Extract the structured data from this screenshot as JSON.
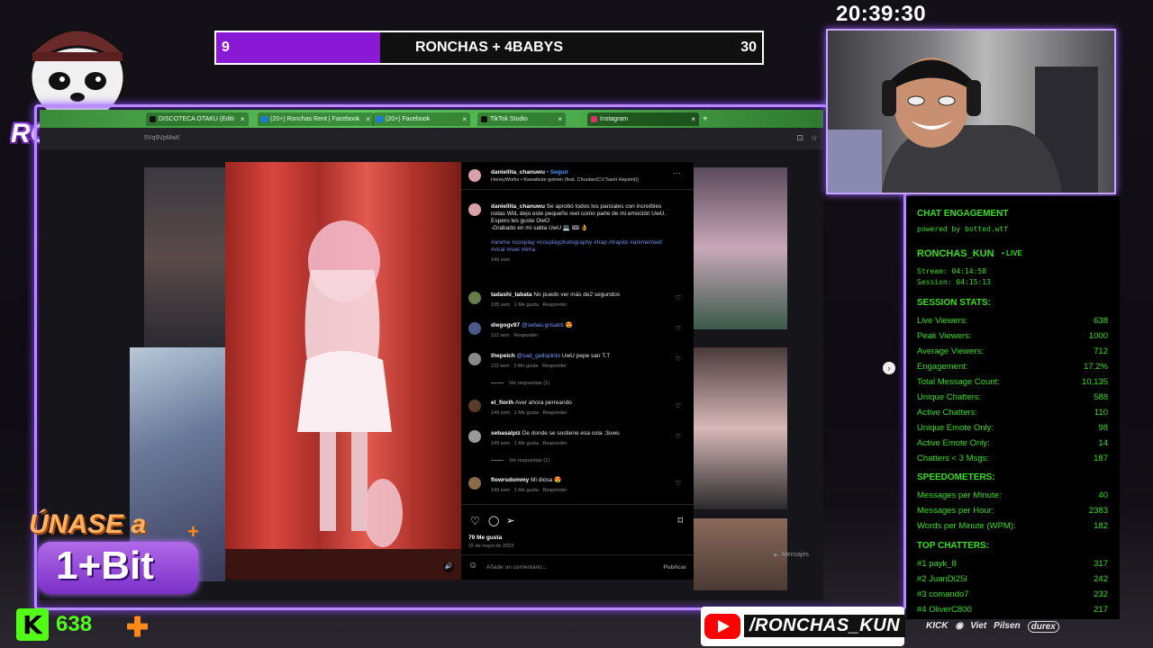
{
  "scoreboard": {
    "left_value": "9",
    "title": "RONCHAS + 4BABYS",
    "right_value": "30",
    "progress_fraction": 0.3,
    "fill_color": "#8a19d6"
  },
  "clock": "20:39:30",
  "logo": {
    "text": "RONCHAS"
  },
  "browser": {
    "tabs": [
      {
        "label": "DISCOTECA OTAKU (Editi",
        "icon": "tiktok-icon"
      },
      {
        "label": "(20+) Ronchas Rent | Facebook",
        "icon": "facebook-icon"
      },
      {
        "label": "(20+) Facebook",
        "icon": "facebook-icon"
      },
      {
        "label": "TikTok Studio",
        "icon": "tiktok-icon"
      },
      {
        "label": "Instagram",
        "icon": "instagram-icon"
      }
    ],
    "url": "5Vq9VpMwI/"
  },
  "post": {
    "username": "daniellita_chanuwu",
    "follow": "Seguir",
    "audio": "HoneyWorks • Kawaikute gomen (feat. Chuutan(CV:Saori Hayami))",
    "caption_user": "daniellita_chanuwu",
    "caption_text": "Se aprobó todos los parciales con increíbles notas WiiL dejo este pequeño reel como parte de mi emoción UwU.",
    "caption_line2": "Espero les guste OwO",
    "caption_line3": "-Grabado en mi salita UwU 💻 🎟 👌",
    "hashtags": "#anime #cosplay #cosplayphotography #trap #trapito #animemaid #viral #reel #lima",
    "caption_age": "149 sem",
    "likes": "79 Me gusta",
    "date": "15 de mayo de 2023",
    "comment_placeholder": "Añade un comentario...",
    "publish": "Publicar",
    "messages": "Mensajes"
  },
  "comments": [
    {
      "user": "tadashi_tabata",
      "mention": "",
      "text": "No puedo ver más de2 segundos",
      "age": "105 sem",
      "likes": "1 Me gusta",
      "reply": "Responder",
      "avatar_color": "#6a7a4a"
    },
    {
      "user": "diegogv97",
      "mention": "@sebas.grisanti",
      "text": "😍",
      "age": "112 sem",
      "likes": "",
      "reply": "Responder",
      "avatar_color": "#4a5a8a"
    },
    {
      "user": "thepeich",
      "mention": "@sad_gallopinto",
      "text": "UwU pepe san T.T",
      "age": "112 sem",
      "likes": "3 Me gusta",
      "reply": "Responder",
      "avatar_color": "#8a8a8a",
      "view_replies": "Ver respuestas (1)"
    },
    {
      "user": "el_fiorih",
      "mention": "",
      "text": "Aver ahora perreando",
      "age": "149 sem",
      "likes": "1 Me gusta",
      "reply": "Responder",
      "avatar_color": "#5a3a2a"
    },
    {
      "user": "sebasalpiz",
      "mention": "",
      "text": "De donde se sostiene esa cola :3uwu",
      "age": "149 sem",
      "likes": "1 Me gusta",
      "reply": "Responder",
      "avatar_color": "#9a9a9a",
      "view_replies": "Ver respuestas (1)"
    },
    {
      "user": "flowrsdommy",
      "mention": "",
      "text": "Mi diosa 😍",
      "age": "149 sem",
      "likes": "1 Me gusta",
      "reply": "Responder",
      "avatar_color": "#8a6a4a"
    }
  ],
  "chat": {
    "title": "CHAT ENGAGEMENT",
    "powered": "powered by botted.wtf",
    "channel": "RONCHAS_KUN",
    "live": "• LIVE",
    "stream": "Stream: 04:14:58",
    "session": "Session: 04:15:13",
    "session_stats_title": "SESSION STATS:",
    "stats": [
      {
        "label": "Live Viewers:",
        "value": "638"
      },
      {
        "label": "Peak Viewers:",
        "value": "1000"
      },
      {
        "label": "Average Viewers:",
        "value": "712"
      },
      {
        "label": "Engagement:",
        "value": "17.2%"
      },
      {
        "label": "Total Message Count:",
        "value": "10,135"
      },
      {
        "label": "Unique Chatters:",
        "value": "588"
      },
      {
        "label": "Active Chatters:",
        "value": "110"
      },
      {
        "label": "Unique Emote Only:",
        "value": "98"
      },
      {
        "label": "Active Emote Only:",
        "value": "14"
      },
      {
        "label": "Chatters < 3 Msgs:",
        "value": "187"
      }
    ],
    "speed_title": "SPEEDOMETERS:",
    "speed": [
      {
        "label": "Messages per Minute:",
        "value": "40"
      },
      {
        "label": "Messages per Hour:",
        "value": "2383"
      },
      {
        "label": "Words per Minute (WPM):",
        "value": "182"
      }
    ],
    "top_title": "TOP CHATTERS:",
    "top": [
      {
        "label": "#1 payk_8",
        "value": "317"
      },
      {
        "label": "#2 JuanDi25l",
        "value": "242"
      },
      {
        "label": "#3 comando7",
        "value": "232"
      },
      {
        "label": "#4 OliverC800",
        "value": "217"
      }
    ]
  },
  "badge": {
    "line1": "ÚNASE a",
    "line2": "1+Bit"
  },
  "kick_viewers": "638",
  "youtube_handle": "/RONCHAS_KUN",
  "sponsors": [
    "KICK",
    "Viet",
    "Pilsen",
    "durex"
  ]
}
